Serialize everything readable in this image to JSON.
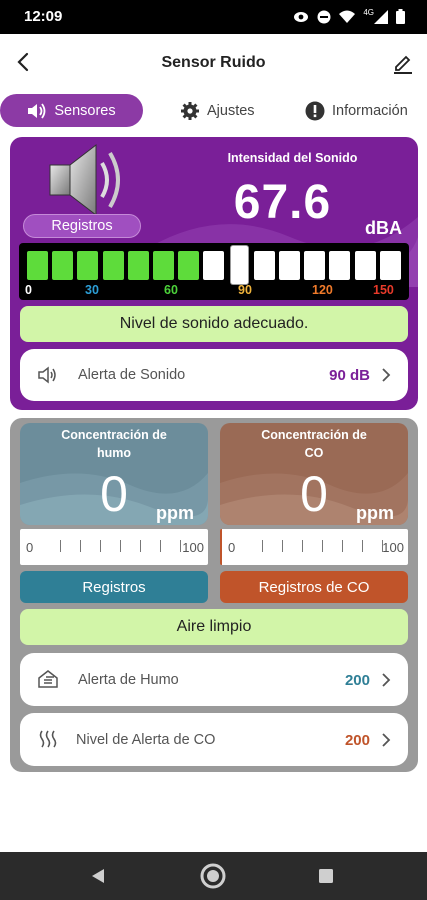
{
  "status_bar": {
    "time": "12:09",
    "network": "4G"
  },
  "app_bar": {
    "title": "Sensor Ruido",
    "back_icon": "back-arrow-icon",
    "edit_icon": "edit-pencil-icon"
  },
  "tabs": [
    {
      "label": "Sensores",
      "icon": "speaker-icon",
      "active": true
    },
    {
      "label": "Ajustes",
      "icon": "gear-icon",
      "active": false
    },
    {
      "label": "Información",
      "icon": "info-icon",
      "active": false
    }
  ],
  "sound": {
    "records_label": "Registros",
    "intensity_label": "Intensidad del Sonido",
    "value": "67.6",
    "unit": "dBA",
    "meter": {
      "level": 67.6,
      "max": 150,
      "ticks": [
        {
          "label": "0",
          "color": "#ffffff"
        },
        {
          "label": "30",
          "color": "#2c9ed6"
        },
        {
          "label": "60",
          "color": "#4cd23a"
        },
        {
          "label": "90",
          "color": "#f0b43c"
        },
        {
          "label": "120",
          "color": "#f07a2a"
        },
        {
          "label": "150",
          "color": "#e83a2a"
        }
      ]
    },
    "status_text": "Nivel de sonido adecuado.",
    "alert": {
      "label": "Alerta de Sonido",
      "value": "90 dB",
      "icon": "speaker-outline-icon"
    }
  },
  "gas": {
    "smoke": {
      "label_line1": "Concentración de",
      "label_line2": "humo",
      "value": "0",
      "unit": "ppm",
      "scale_min": "0",
      "scale_max": "100",
      "records_label": "Registros"
    },
    "co": {
      "label_line1": "Concentración de",
      "label_line2": "CO",
      "value": "0",
      "unit": "ppm",
      "scale_min": "0",
      "scale_max": "100",
      "records_label": "Registros de CO"
    },
    "status_text": "Aire limpio",
    "smoke_alert": {
      "label": "Alerta de Humo",
      "value": "200",
      "icon": "smoke-house-icon"
    },
    "co_alert": {
      "label": "Nivel de Alerta de CO",
      "value": "200",
      "icon": "heat-waves-icon"
    }
  },
  "colors": {
    "purple": "#7a1f98",
    "tab_active": "#8c3aa5",
    "smoke_panel": "#6c8d9b",
    "smoke_button": "#2f7f96",
    "co_panel": "#9a6a55",
    "co_button": "#c0542a",
    "green_bar": "#d2f5a8",
    "smoke_value": "#2f7f96",
    "co_value": "#c0542a",
    "sound_value": "#7a1f98"
  }
}
